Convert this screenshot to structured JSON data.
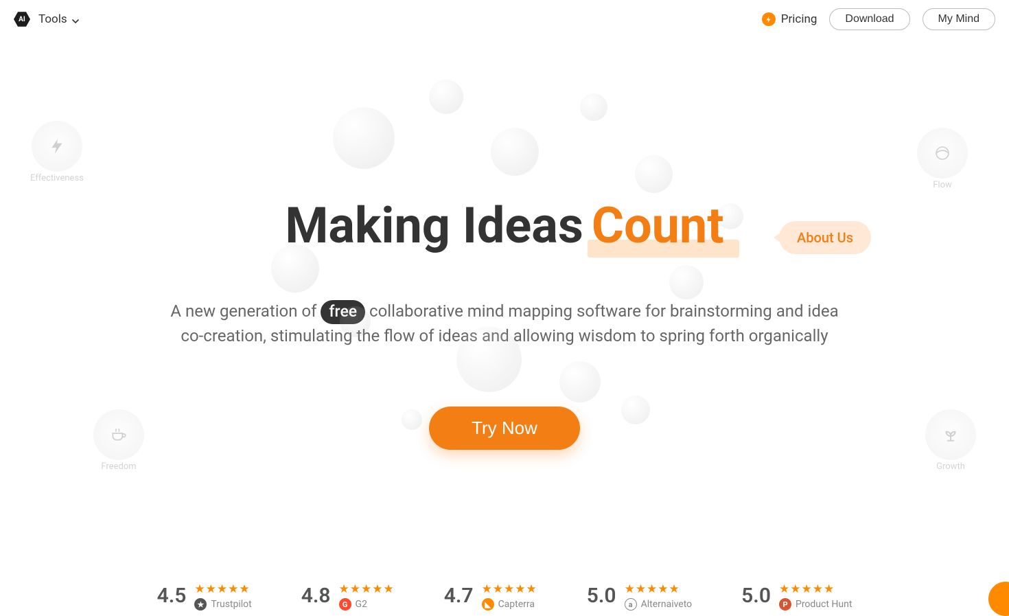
{
  "logo_text": "AI",
  "nav": {
    "tools_label": "Tools",
    "pricing_label": "Pricing",
    "download_label": "Download",
    "my_mind_label": "My Mind"
  },
  "hero": {
    "title_prefix": "Making Ideas",
    "title_accent": "Count",
    "about_us_label": "About Us",
    "subtitle_before": "A new generation of",
    "subtitle_free": "free",
    "subtitle_after": "collaborative mind mapping software for brainstorming and idea co-creation, stimulating the flow of ideas and allowing wisdom to spring forth organically",
    "cta_label": "Try Now"
  },
  "features": {
    "effectiveness": "Effectiveness",
    "flow": "Flow",
    "freedom": "Freedom",
    "growth": "Growth"
  },
  "ratings": [
    {
      "score": "4.5",
      "source": "Trustpilot"
    },
    {
      "score": "4.8",
      "source": "G2"
    },
    {
      "score": "4.7",
      "source": "Capterra"
    },
    {
      "score": "5.0",
      "source": "Alternaiveto"
    },
    {
      "score": "5.0",
      "source": "Product Hunt"
    }
  ],
  "stars": "★★★★★",
  "colors": {
    "accent": "#f27e14",
    "accent_light": "#ffe9d6"
  }
}
